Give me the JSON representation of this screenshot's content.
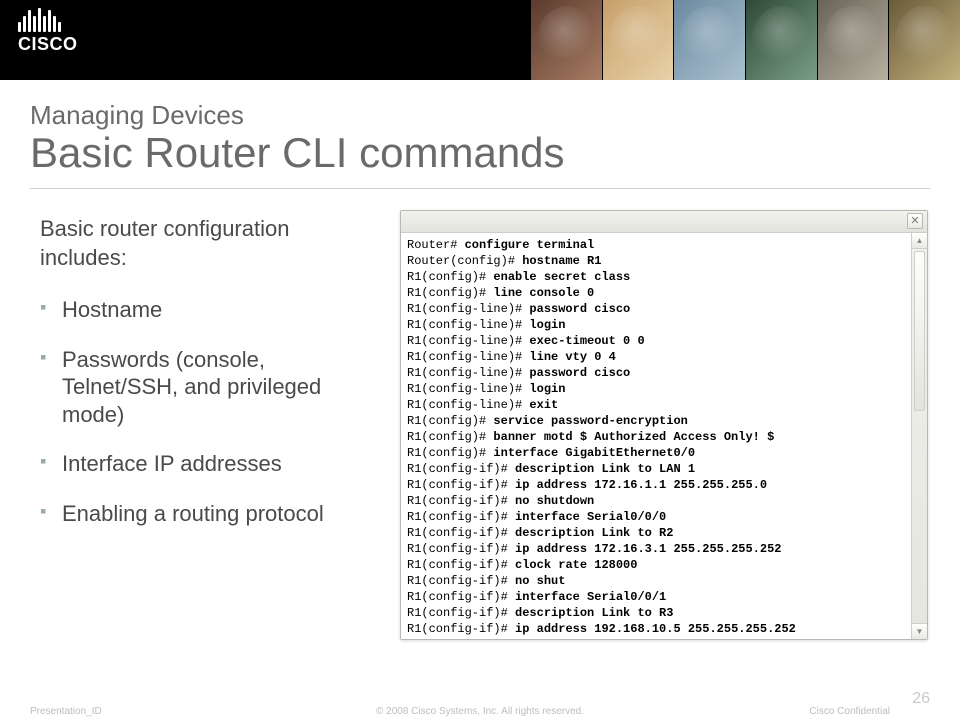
{
  "logo": "CISCO",
  "heading": {
    "overline": "Managing Devices",
    "title": "Basic Router CLI commands"
  },
  "body": {
    "lead": "Basic router configuration includes:",
    "bullets": [
      "Hostname",
      "Passwords (console, Telnet/SSH, and privileged mode)",
      "Interface IP addresses",
      "Enabling a routing protocol"
    ]
  },
  "terminal": {
    "lines": [
      {
        "prompt": "Router#",
        "cmd": "configure terminal"
      },
      {
        "prompt": "Router(config)#",
        "cmd": "hostname R1"
      },
      {
        "prompt": "R1(config)#",
        "cmd": "enable secret class"
      },
      {
        "prompt": "R1(config)#",
        "cmd": "line console 0"
      },
      {
        "prompt": "R1(config-line)#",
        "cmd": "password cisco"
      },
      {
        "prompt": "R1(config-line)#",
        "cmd": "login"
      },
      {
        "prompt": "R1(config-line)#",
        "cmd": "exec-timeout 0 0"
      },
      {
        "prompt": "R1(config-line)#",
        "cmd": "line vty 0 4"
      },
      {
        "prompt": "R1(config-line)#",
        "cmd": "password cisco"
      },
      {
        "prompt": "R1(config-line)#",
        "cmd": "login"
      },
      {
        "prompt": "R1(config-line)#",
        "cmd": "exit"
      },
      {
        "prompt": "R1(config)#",
        "cmd": "service password-encryption"
      },
      {
        "prompt": "R1(config)#",
        "cmd": "banner motd $ Authorized Access Only! $"
      },
      {
        "prompt": "R1(config)#",
        "cmd": "interface GigabitEthernet0/0"
      },
      {
        "prompt": "R1(config-if)#",
        "cmd": "description Link to LAN 1"
      },
      {
        "prompt": "R1(config-if)#",
        "cmd": "ip address 172.16.1.1 255.255.255.0"
      },
      {
        "prompt": "R1(config-if)#",
        "cmd": "no shutdown"
      },
      {
        "prompt": "R1(config-if)#",
        "cmd": "interface Serial0/0/0"
      },
      {
        "prompt": "R1(config-if)#",
        "cmd": "description Link to R2"
      },
      {
        "prompt": "R1(config-if)#",
        "cmd": "ip address 172.16.3.1 255.255.255.252"
      },
      {
        "prompt": "R1(config-if)#",
        "cmd": "clock rate 128000"
      },
      {
        "prompt": "R1(config-if)#",
        "cmd": "no shut"
      },
      {
        "prompt": "R1(config-if)#",
        "cmd": "interface Serial0/0/1"
      },
      {
        "prompt": "R1(config-if)#",
        "cmd": "description Link to R3"
      },
      {
        "prompt": "R1(config-if)#",
        "cmd": "ip address 192.168.10.5 255.255.255.252"
      }
    ]
  },
  "footer": {
    "left": "Presentation_ID",
    "center": "© 2008 Cisco Systems, Inc. All rights reserved.",
    "right": "Cisco Confidential",
    "page": "26"
  }
}
